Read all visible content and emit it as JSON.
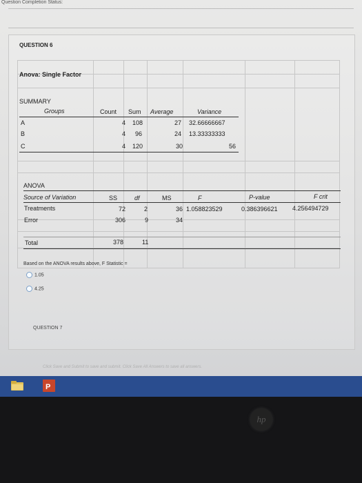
{
  "status": {
    "label": "Question Completion Status:"
  },
  "question6": {
    "label": "QUESTION 6"
  },
  "anova_title": "Anova: Single Factor",
  "summary": {
    "title": "SUMMARY",
    "headers": [
      "Groups",
      "Count",
      "Sum",
      "Average",
      "Variance"
    ],
    "rows": [
      {
        "group": "A",
        "count": "4",
        "sum": "108",
        "average": "27",
        "variance": "32.66666667"
      },
      {
        "group": "B",
        "count": "4",
        "sum": "96",
        "average": "24",
        "variance": "13.33333333"
      },
      {
        "group": "C",
        "count": "4",
        "sum": "120",
        "average": "30",
        "variance": "56"
      }
    ]
  },
  "anova": {
    "title": "ANOVA",
    "headers": [
      "Source of Variation",
      "SS",
      "df",
      "MS",
      "F",
      "P-value",
      "F crit"
    ],
    "treatments": {
      "name": "Treatments",
      "ss": "72",
      "df": "2",
      "ms": "36",
      "f": "1.058823529",
      "p": "0.386396621",
      "fcrit": "4.256494729"
    },
    "error": {
      "name": "Error",
      "ss": "306",
      "df": "9",
      "ms": "34"
    },
    "total": {
      "name": "Total",
      "ss": "378",
      "df": "11"
    }
  },
  "prompt": "Based on the ANOVA results above, F Statistic =",
  "options": [
    "1.05",
    "4.25"
  ],
  "question7": {
    "label": "QUESTION 7"
  },
  "submit_hint": "Click Save and Submit to save and submit. Click Save All Answers to save all answers.",
  "taskbar": {
    "app_icon": "folder-icon",
    "second_icon": "powerpoint-icon"
  },
  "bezel": {
    "logo": "hp"
  }
}
